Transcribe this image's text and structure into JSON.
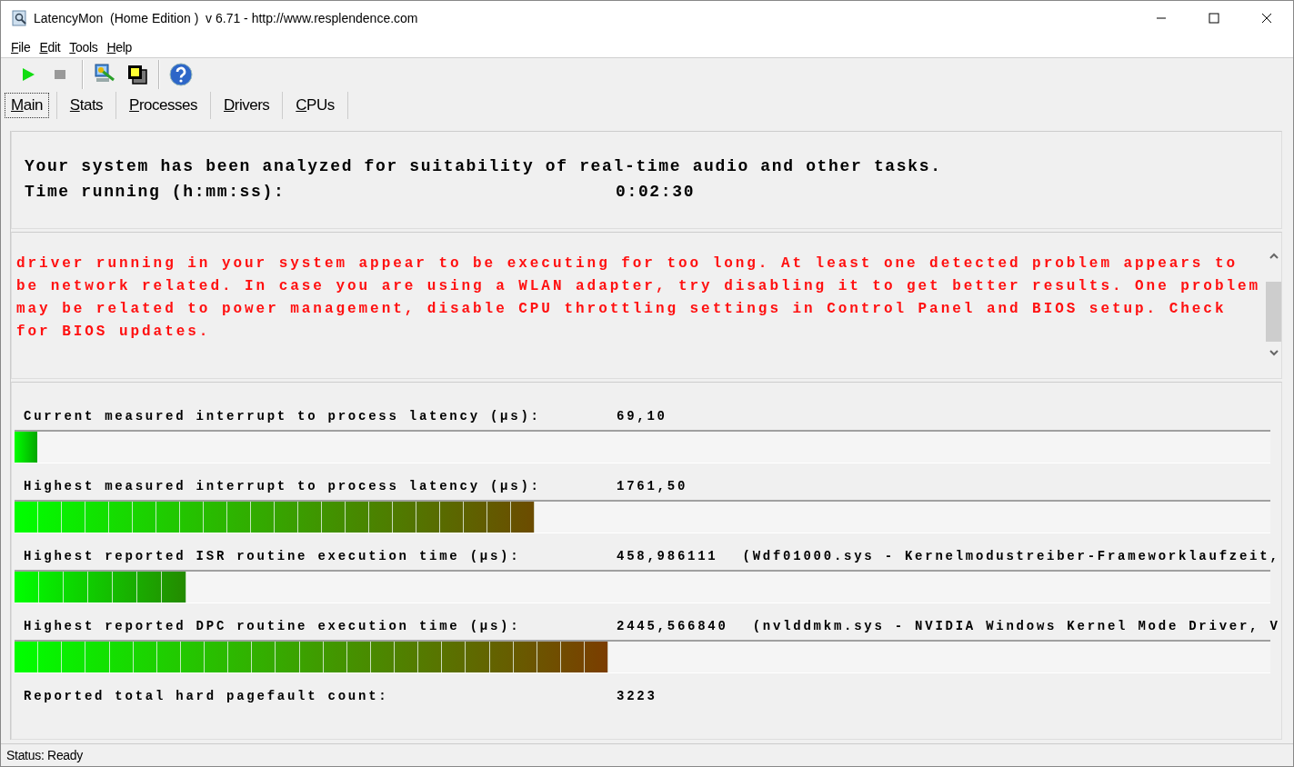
{
  "window": {
    "title": "LatencyMon  (Home Edition )  v 6.71 - http://www.resplendence.com"
  },
  "menu": [
    "File",
    "Edit",
    "Tools",
    "Help"
  ],
  "toolbar": [
    {
      "kind": "play",
      "disabled": false
    },
    {
      "kind": "stop",
      "disabled": true
    },
    {
      "kind": "monitor",
      "disabled": false
    },
    {
      "kind": "windows",
      "disabled": false
    },
    {
      "kind": "help",
      "disabled": false
    }
  ],
  "tabs": [
    {
      "label": "Main",
      "selected": true
    },
    {
      "label": "Stats",
      "selected": false
    },
    {
      "label": "Processes",
      "selected": false
    },
    {
      "label": "Drivers",
      "selected": false
    },
    {
      "label": "CPUs",
      "selected": false
    }
  ],
  "summary": {
    "text": "Your system has been analyzed for suitability of real-time audio and other tasks.",
    "time_label": "Time running (h:mm:ss):",
    "time_value": "0:02:30"
  },
  "warning": {
    "text": "driver running in your system appear to be executing for too long. At least one detected problem appears to be network related. In case you are using a WLAN adapter, try disabling it to get better results. One problem may be related to power management, disable CPU throttling settings in Control Panel and BIOS setup. Check for BIOS updates."
  },
  "metrics": [
    {
      "kind": "meter",
      "label": "Current measured interrupt to process latency (µs):",
      "value": "69,10",
      "level": 0.018
    },
    {
      "kind": "meter",
      "label": "Highest measured interrupt to process latency (µs):",
      "value": "1761,50",
      "level": 0.414
    },
    {
      "kind": "meter",
      "label": "Highest reported ISR routine execution time (µs):",
      "value": "458,986111",
      "detail": "(Wdf01000.sys - Kernelmodustreiber-Frameworklaufzeit,",
      "level": 0.137
    },
    {
      "kind": "meter",
      "label": "Highest reported DPC routine execution time (µs):",
      "value": "2445,566840",
      "detail": "(nvlddmkm.sys - NVIDIA Windows Kernel Mode Driver, V",
      "level": 0.473
    },
    {
      "kind": "count",
      "label": "Reported total hard pagefault count:",
      "value": "3223"
    }
  ],
  "status_bar": "Status: Ready"
}
